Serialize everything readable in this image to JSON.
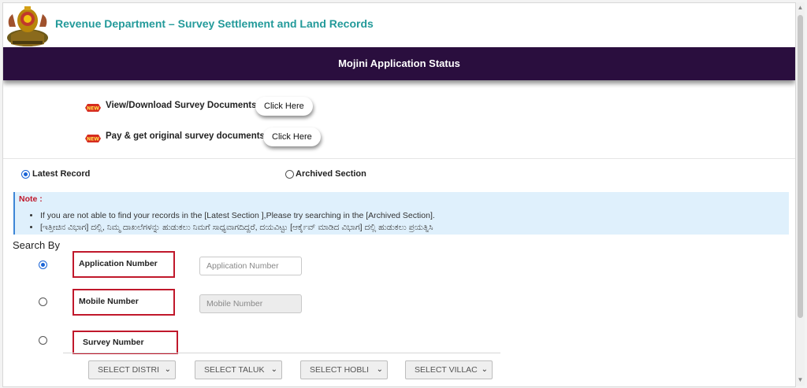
{
  "header": {
    "dept_title": "Revenue Department – Survey Settlement and Land Records",
    "emblem_icon": "karnataka-emblem"
  },
  "banner": {
    "title": "Mojini Application Status"
  },
  "links": [
    {
      "badge": "NEW",
      "text": "View/Download Survey Documents",
      "button": "Click Here"
    },
    {
      "badge": "NEW",
      "text": "Pay & get original survey documents",
      "button": "Click Here"
    }
  ],
  "record_section": {
    "options": [
      {
        "label": "Latest Record",
        "selected": true
      },
      {
        "label": "Archived Section",
        "selected": false
      }
    ]
  },
  "note": {
    "title": "Note :",
    "items": [
      "If you are not able to find your records in the [Latest Section ],Please try searching in the [Archived Section].",
      "[ಇತ್ತೀಚಿನ ವಿಭಾಗ] ದಲ್ಲಿ, ನಿಮ್ಮ ದಾಖಲೆಗಳನ್ನು ಹುಡುಕಲು ನಿಮಗೆ ಸಾಧ್ಯವಾಗದಿದ್ದರೆ, ದಯವಿಟ್ಟು [ಆರ್ಕೈವ್ ಮಾಡಿದ ವಿಭಾಗ] ದಲ್ಲಿ ಹುಡುಕಲು ಪ್ರಯತ್ನಿಸಿ"
    ]
  },
  "search": {
    "title": "Search By",
    "application": {
      "label": "Application Number",
      "placeholder": "Application Number",
      "selected": true
    },
    "mobile": {
      "label": "Mobile Number",
      "placeholder": "Mobile Number",
      "selected": false
    },
    "survey": {
      "label": "Survey Number",
      "selected": false
    },
    "selects": [
      "SELECT DISTRI",
      "SELECT TALUK",
      "SELECT HOBLI",
      "SELECT VILLAC"
    ]
  },
  "colors": {
    "banner_bg": "#2a0e3e",
    "title_teal": "#239a9a",
    "highlight_red": "#c0182b",
    "note_bg": "#dff0fc"
  }
}
